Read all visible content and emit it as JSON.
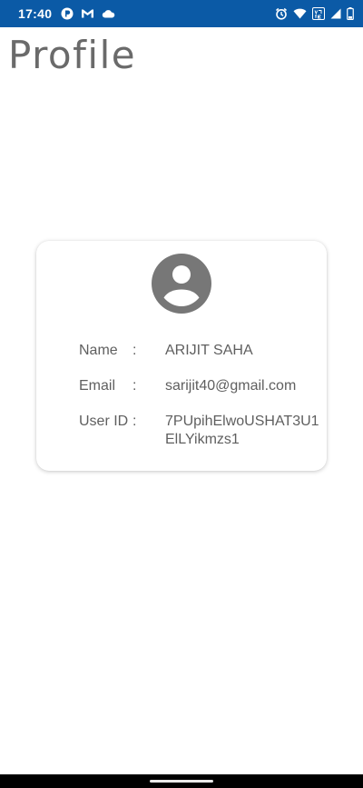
{
  "status_bar": {
    "time": "17:40",
    "icons_left": [
      "notification-p-icon",
      "gmail-icon",
      "cloud-icon"
    ],
    "icons_right": [
      "alarm-icon",
      "wifi-icon",
      "volte-icon",
      "signal-icon",
      "battery-icon"
    ],
    "color": "#0b5aa6"
  },
  "page": {
    "title": "Profile"
  },
  "profile_card": {
    "avatar_icon": "account-circle-icon",
    "rows": [
      {
        "label": "Name",
        "separator": ":",
        "value": "ARIJIT SAHA"
      },
      {
        "label": "Email",
        "separator": ":",
        "value": "sarijit40@gmail.com"
      },
      {
        "label": "User ID",
        "separator": ":",
        "value": "7PUpihElwoUSHAT3U1ElLYikmzs1"
      }
    ]
  }
}
